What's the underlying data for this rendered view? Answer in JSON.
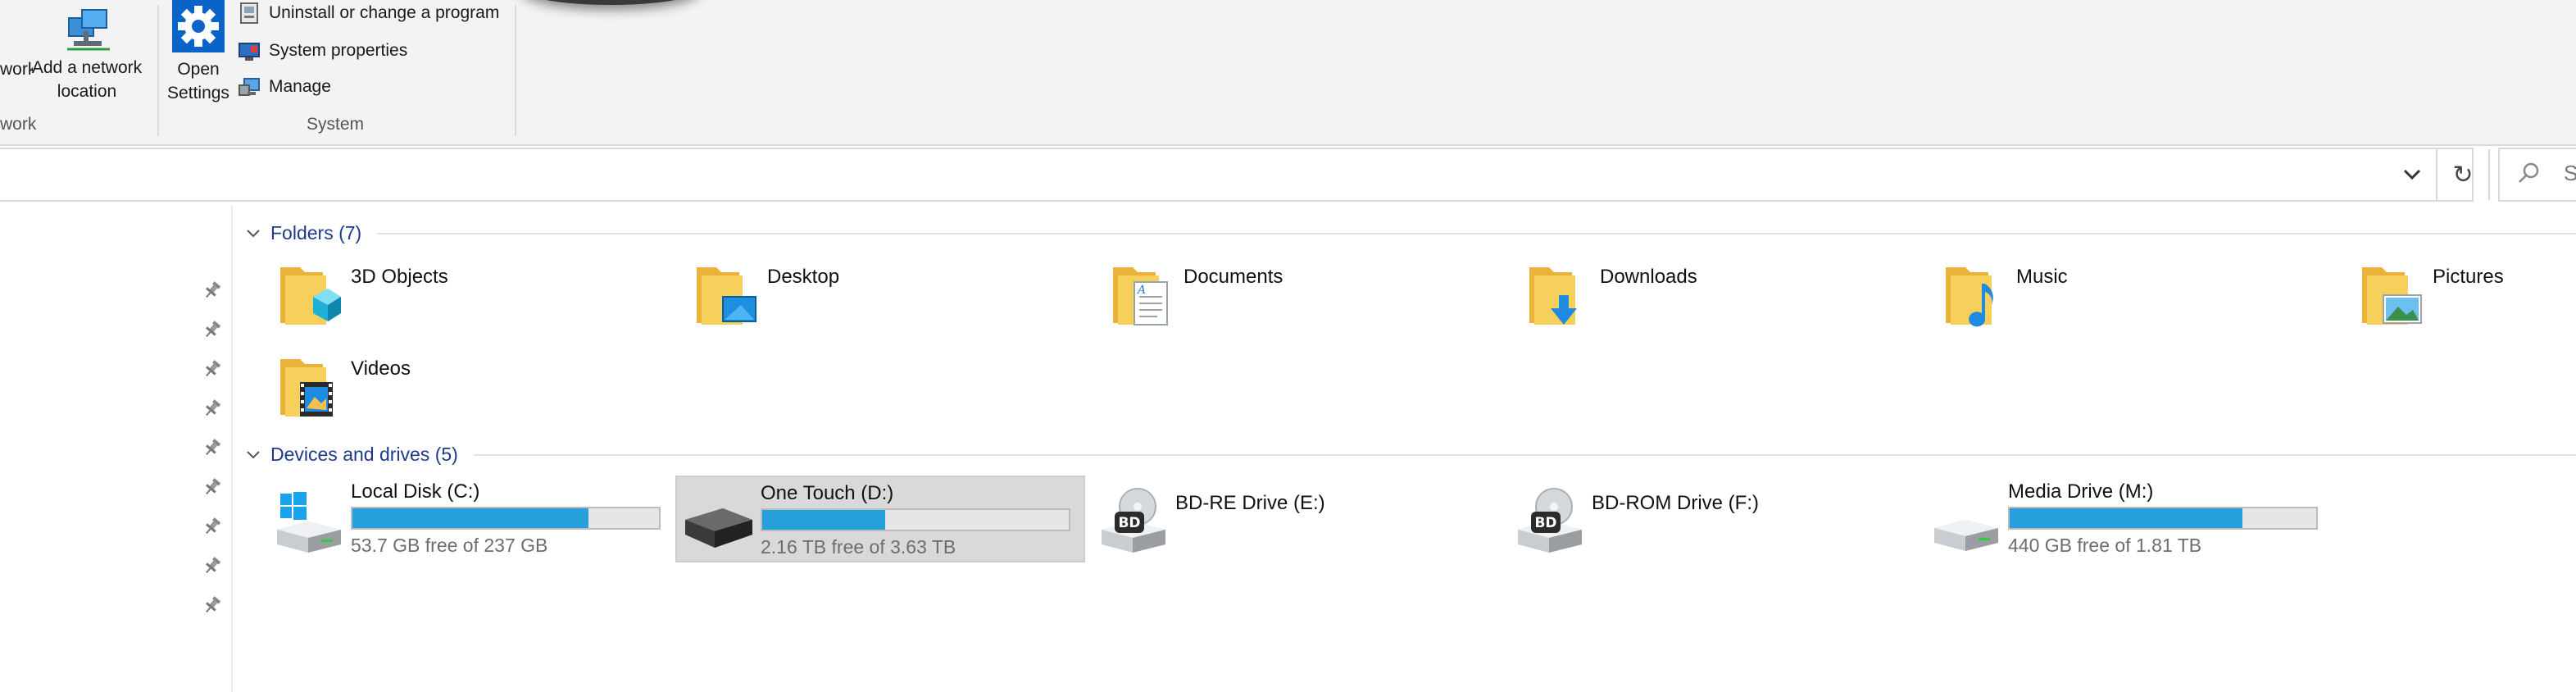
{
  "ribbon": {
    "network_group": {
      "cut_item_label": "work",
      "add_network_location_line1": "Add a network",
      "add_network_location_line2": "location",
      "group_label": "work"
    },
    "system_group": {
      "open_settings_line1": "Open",
      "open_settings_line2": "Settings",
      "uninstall_label": "Uninstall or change a program",
      "system_properties_label": "System properties",
      "manage_label": "Manage",
      "group_label": "System"
    }
  },
  "address_bar": {
    "refresh_glyph": "↻",
    "search_placeholder_partial": "S"
  },
  "nav_pane": {
    "pins": [
      "pin-icon",
      "pin-icon",
      "pin-icon",
      "pin-icon",
      "pin-icon",
      "pin-icon",
      "pin-icon",
      "pin-icon",
      "pin-icon"
    ]
  },
  "folders": {
    "title": "Folders (7)",
    "items": [
      {
        "name": "3D Objects",
        "icon": "3d-objects-folder-icon"
      },
      {
        "name": "Desktop",
        "icon": "desktop-folder-icon"
      },
      {
        "name": "Documents",
        "icon": "documents-folder-icon"
      },
      {
        "name": "Downloads",
        "icon": "downloads-folder-icon"
      },
      {
        "name": "Music",
        "icon": "music-folder-icon"
      },
      {
        "name": "Pictures",
        "icon": "pictures-folder-icon"
      },
      {
        "name": "Videos",
        "icon": "videos-folder-icon"
      }
    ]
  },
  "drives": {
    "title": "Devices and drives (5)",
    "items": [
      {
        "name": "Local Disk (C:)",
        "free": "53.7 GB free of 237 GB",
        "used_fraction": 0.77,
        "icon": "windows-drive-icon",
        "selected": false
      },
      {
        "name": "One Touch (D:)",
        "free": "2.16 TB free of 3.63 TB",
        "used_fraction": 0.4,
        "icon": "external-hdd-icon",
        "selected": true
      },
      {
        "name": "BD-RE Drive (E:)",
        "icon": "bd-drive-icon",
        "selected": false
      },
      {
        "name": "BD-ROM Drive (F:)",
        "icon": "bd-drive-icon",
        "selected": false
      },
      {
        "name": "Media Drive (M:)",
        "free": "440 GB free of 1.81 TB",
        "used_fraction": 0.76,
        "icon": "hdd-icon",
        "selected": false
      }
    ]
  },
  "colors": {
    "accent_blue": "#26a0da",
    "section_title": "#1e3a8a",
    "folder_yellow": "#f6c64a",
    "selection_gray": "#d9d9d9"
  }
}
